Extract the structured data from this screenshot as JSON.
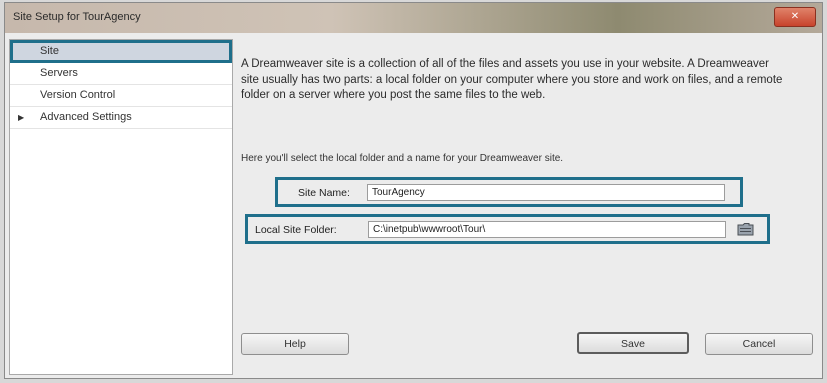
{
  "window": {
    "title": "Site Setup for TourAgency",
    "close_label": "✕"
  },
  "sidebar": {
    "items": [
      {
        "label": "Site",
        "selected": true
      },
      {
        "label": "Servers"
      },
      {
        "label": "Version Control"
      },
      {
        "label": "Advanced Settings",
        "expandable": true,
        "arrow": "▶"
      }
    ]
  },
  "main": {
    "description": "A Dreamweaver site is a collection of all of the files and assets you use in your website. A Dreamweaver site usually has two parts: a local folder on your computer where you store and work on files, and a remote folder on a server where you post the same files to the web.",
    "hint": "Here you'll select the local folder and a name for your Dreamweaver site.",
    "site_name": {
      "label": "Site Name:",
      "value": "TourAgency"
    },
    "local_folder": {
      "label": "Local Site Folder:",
      "value": "C:\\inetpub\\wwwroot\\Tour\\"
    }
  },
  "buttons": {
    "help": "Help",
    "save": "Save",
    "cancel": "Cancel"
  },
  "colors": {
    "highlight": "#1f6f8b"
  },
  "icons": {
    "folder": "folder-icon"
  }
}
